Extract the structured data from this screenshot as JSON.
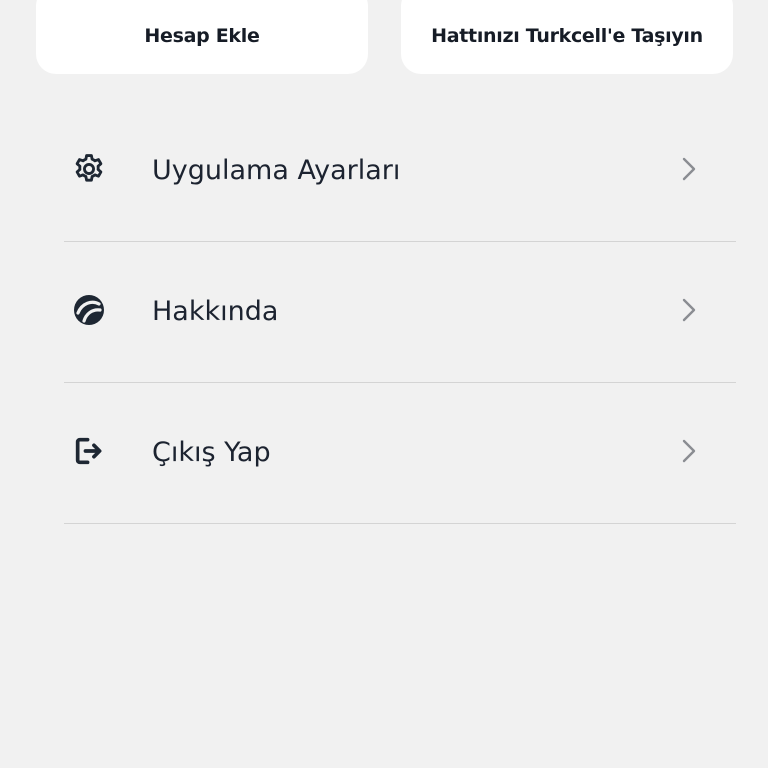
{
  "cards": [
    {
      "label": "Hesap Ekle"
    },
    {
      "label": "Hattınızı Turkcell'e Taşıyın"
    }
  ],
  "menu": {
    "items": [
      {
        "label": "Uygulama Ayarları",
        "icon": "gear-icon"
      },
      {
        "label": "Hakkında",
        "icon": "turkcell-logo-icon"
      },
      {
        "label": "Çıkış Yap",
        "icon": "logout-icon"
      }
    ]
  },
  "colors": {
    "background": "#f1f1f1",
    "card": "#ffffff",
    "text": "#1c2330",
    "chevron": "#8a8d92",
    "divider": "#d4d4d4",
    "accent": "#4a6fd1"
  }
}
